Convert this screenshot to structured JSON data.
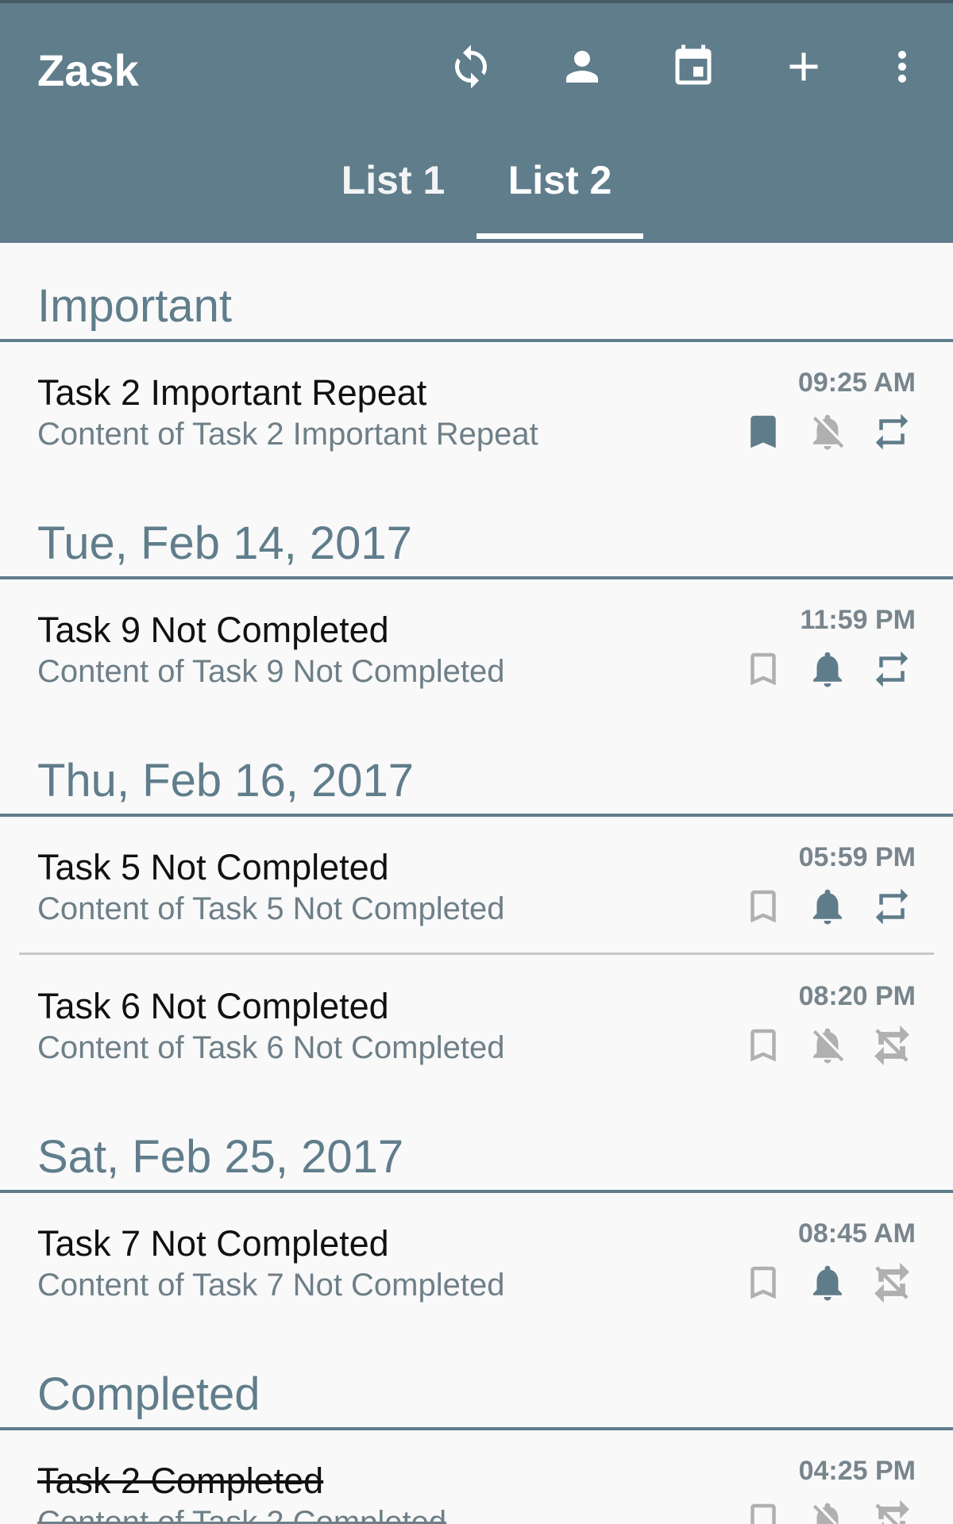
{
  "app": {
    "title": "Zask",
    "toolbar_icons": [
      "sync-icon",
      "account-icon",
      "calendar-icon",
      "add-icon",
      "more-vert-icon"
    ]
  },
  "tabs": [
    {
      "label": "List 1",
      "selected": false
    },
    {
      "label": "List 2",
      "selected": true
    }
  ],
  "colors": {
    "primary": "#607d8b",
    "active_icon": "#5f7c8a",
    "inactive_icon": "#b0b0b0",
    "title_text": "#111111",
    "content_text": "#6e7f88"
  },
  "sections": [
    {
      "label": "Important"
    },
    {
      "label": "Tue, Feb 14, 2017"
    },
    {
      "label": "Thu, Feb 16, 2017"
    },
    {
      "label": "Sat, Feb 25, 2017"
    },
    {
      "label": "Completed"
    }
  ],
  "tasks": [
    {
      "title": "Task 2 Important Repeat",
      "content": "Content of Task 2 Important Repeat",
      "time": "09:25 AM",
      "important": true,
      "reminder": false,
      "repeat": true,
      "completed": false
    },
    {
      "title": "Task 9 Not Completed",
      "content": "Content of Task 9 Not Completed",
      "time": "11:59 PM",
      "important": false,
      "reminder": true,
      "repeat": true,
      "completed": false
    },
    {
      "title": "Task 5 Not Completed",
      "content": "Content of Task 5 Not Completed",
      "time": "05:59 PM",
      "important": false,
      "reminder": true,
      "repeat": true,
      "completed": false
    },
    {
      "title": "Task 6 Not Completed",
      "content": "Content of Task 6 Not Completed",
      "time": "08:20 PM",
      "important": false,
      "reminder": false,
      "repeat": false,
      "completed": false
    },
    {
      "title": "Task 7 Not Completed",
      "content": "Content of Task 7 Not Completed",
      "time": "08:45 AM",
      "important": false,
      "reminder": true,
      "repeat": false,
      "completed": false
    },
    {
      "title": "Task 2 Completed",
      "content": "Content of Task 2 Completed",
      "time": "04:25 PM",
      "important": false,
      "reminder": false,
      "repeat": false,
      "completed": true
    }
  ]
}
